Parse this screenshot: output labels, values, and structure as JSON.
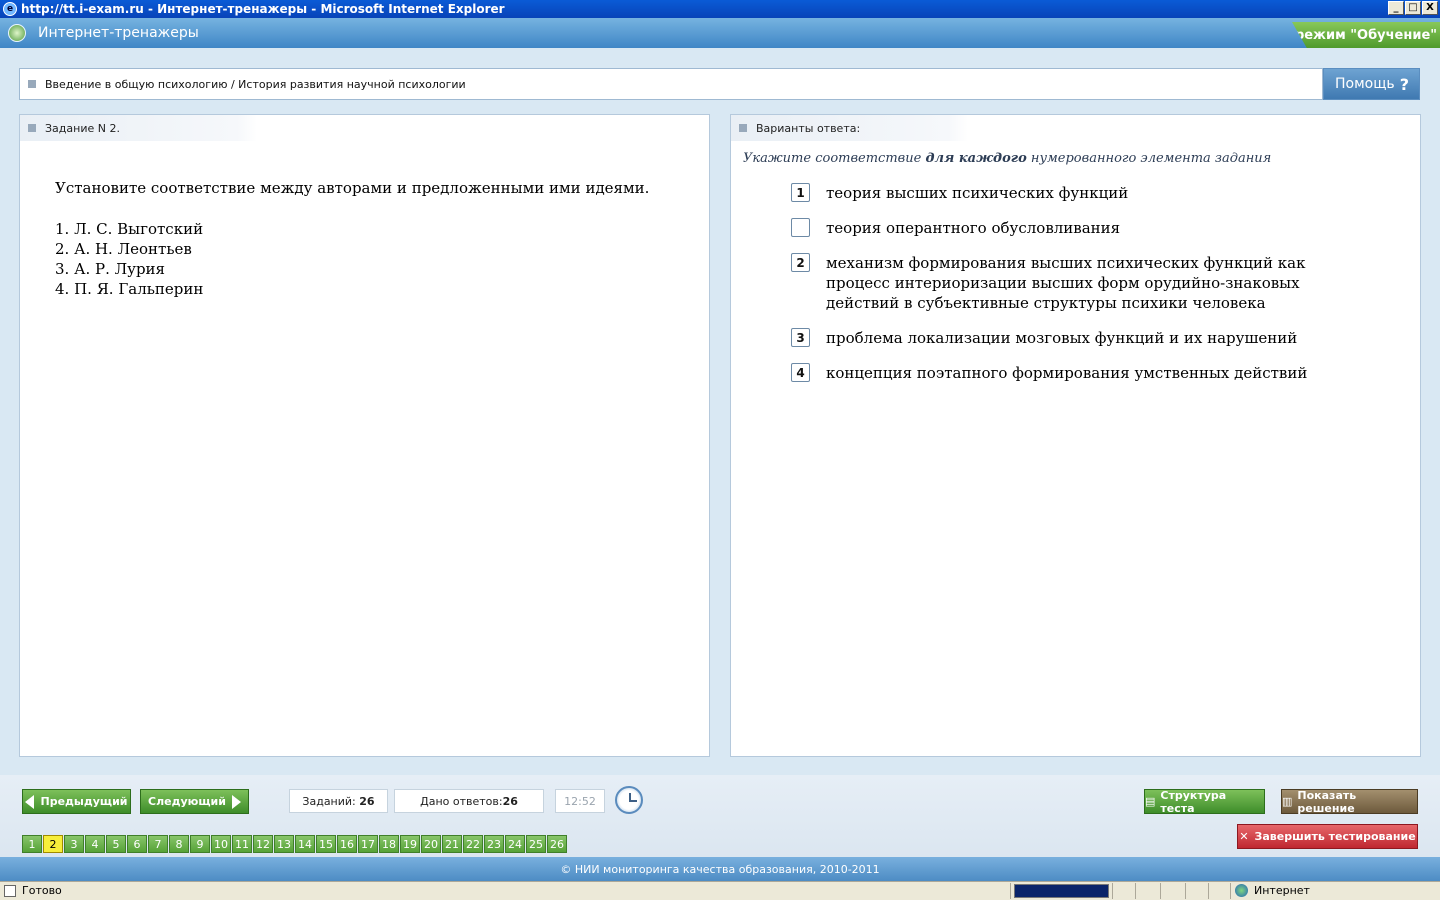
{
  "window": {
    "title": "http://tt.i-exam.ru - Интернет-тренажеры - Microsoft Internet Explorer",
    "minimize": "_",
    "maximize": "□",
    "close": "X"
  },
  "app": {
    "title": "Интернет-тренажеры",
    "mode": "режим \"Обучение\""
  },
  "breadcrumb": "Введение в общую психологию / История развития научной психологии",
  "help_label": "Помощь",
  "help_icon": "?",
  "task": {
    "header": "Задание N 2.",
    "question": "Установите соответствие между авторами и предложенными ими идеями.",
    "items": [
      "1. Л. С. Выготский",
      "2. А. Н. Леонтьев",
      "3. А. Р. Лурия",
      "4. П. Я. Гальперин"
    ]
  },
  "answers": {
    "header": "Варианты ответа:",
    "instruction_pre": "Укажите соответствие ",
    "instruction_bold": "для каждого",
    "instruction_post": " нумерованного элемента задания",
    "options": [
      {
        "value": "1",
        "text": "теория высших психических функций"
      },
      {
        "value": "",
        "text": "теория оперантного обусловливания"
      },
      {
        "value": "2",
        "text": "механизм формирования высших психических функций как процесс интериоризации высших форм орудийно-знаковых действий в субъективные структуры психики человека"
      },
      {
        "value": "3",
        "text": "проблема локализации мозговых функций и их нарушений"
      },
      {
        "value": "4",
        "text": "концепция поэтапного формирования умственных действий"
      }
    ]
  },
  "nav": {
    "prev_label": "Предыдущий",
    "next_label": "Следующий",
    "tasks_label": "Заданий:",
    "tasks_count": "26",
    "answered_label": "Дано ответов:",
    "answered_count": "26",
    "timer": "12:52",
    "structure_label": "Структура теста",
    "solution_label": "Показать решение",
    "finish_label": "Завершить тестирование",
    "pages": [
      "1",
      "2",
      "3",
      "4",
      "5",
      "6",
      "7",
      "8",
      "9",
      "10",
      "11",
      "12",
      "13",
      "14",
      "15",
      "16",
      "17",
      "18",
      "19",
      "20",
      "21",
      "22",
      "23",
      "24",
      "25",
      "26"
    ],
    "current_page": "2"
  },
  "footer": "© НИИ мониторинга качества образования, 2010-2011",
  "statusbar": {
    "ready": "Готово",
    "zone": "Интернет"
  }
}
